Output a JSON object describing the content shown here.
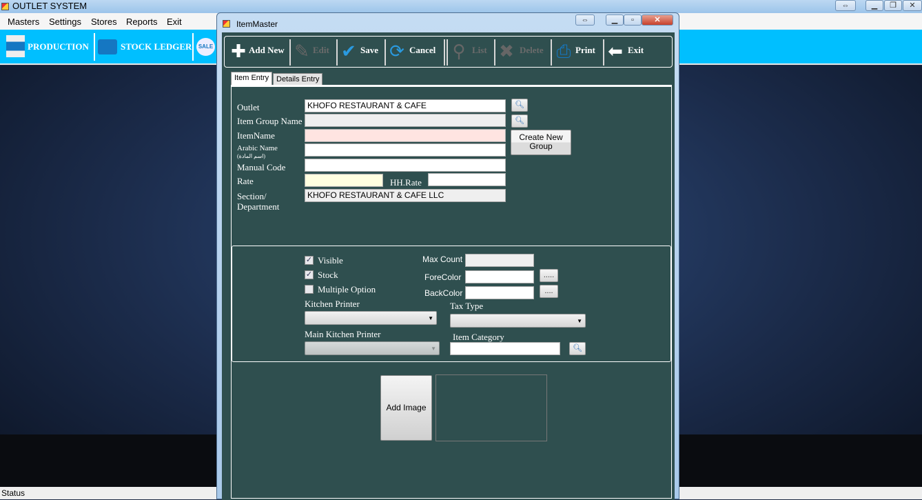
{
  "app": {
    "title": "OUTLET SYSTEM",
    "menu": [
      "Masters",
      "Settings",
      "Stores",
      "Reports",
      "Exit"
    ],
    "toolbar": {
      "production": "PRODUCTION",
      "stock_ledger": "STOCK LEDGER",
      "sale_icon_text": "SALE"
    },
    "status": "Status"
  },
  "dialog": {
    "title": "ItemMaster",
    "toolbar": {
      "add_new": "Add New",
      "edit": "Edit",
      "save": "Save",
      "cancel": "Cancel",
      "list": "List",
      "delete": "Delete",
      "print": "Print",
      "exit": "Exit"
    },
    "tabs": [
      "Item Entry",
      "Details Entry"
    ],
    "form": {
      "outlet_label": "Outlet",
      "outlet_value": "KHOFO RESTAURANT & CAFE",
      "item_group_label": "Item Group Name",
      "item_group_value": "",
      "item_name_label": "ItemName",
      "item_name_value": "",
      "arabic_name_label": "Arabic Name",
      "arabic_name_sub": "(اسم المادة)",
      "arabic_name_value": "",
      "manual_code_label": "Manual Code",
      "manual_code_value": "",
      "rate_label": "Rate",
      "rate_value": "",
      "hh_rate_label": "HH.Rate",
      "hh_rate_value": "",
      "section_label_1": "Section/",
      "section_label_2": "Department",
      "section_value": "KHOFO RESTAURANT & CAFE LLC",
      "create_group_1": "Create New",
      "create_group_2": "Group"
    },
    "options": {
      "visible_label": "Visible",
      "visible_checked": true,
      "stock_label": "Stock",
      "stock_checked": true,
      "multiple_label": "Multiple Option",
      "multiple_checked": false,
      "max_count_label": "Max Count",
      "fore_color_label": "ForeColor",
      "back_color_label": "BackColor",
      "fore_btn": ".....",
      "back_btn": "....",
      "kitchen_printer_label": "Kitchen Printer",
      "tax_type_label": "Tax Type",
      "main_kitchen_printer_label": "Main Kitchen Printer",
      "item_category_label": "Item Category"
    },
    "image": {
      "add_image": "Add Image"
    }
  }
}
